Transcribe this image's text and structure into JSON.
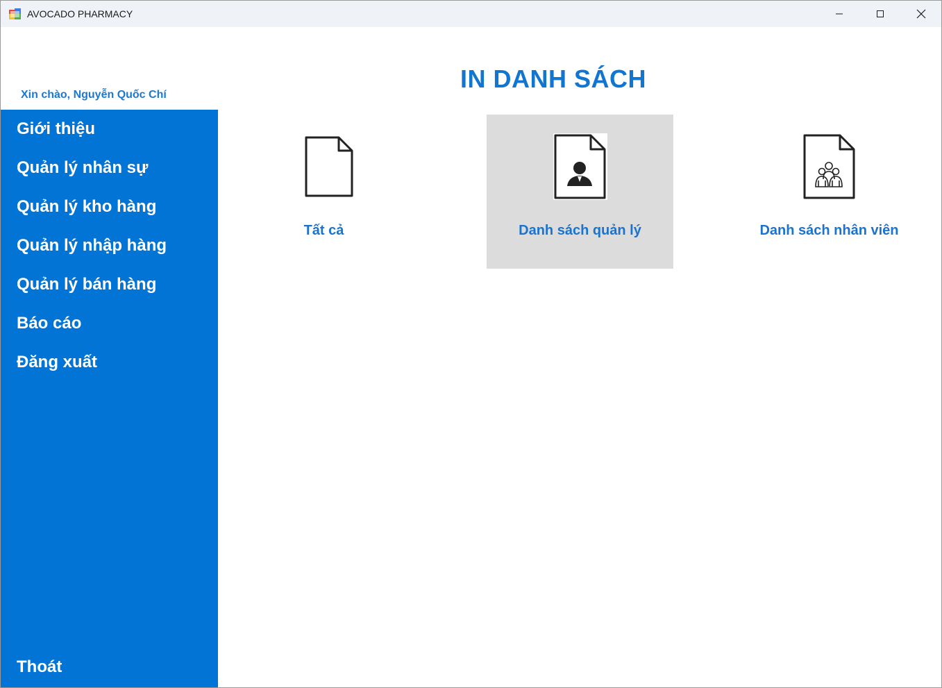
{
  "window": {
    "title": "AVOCADO PHARMACY",
    "controls": [
      "minimize-icon",
      "maximize-icon",
      "close-icon"
    ]
  },
  "user": {
    "greeting": "Xin chào, Nguyễn Quốc Chí"
  },
  "sidebar": {
    "items": [
      {
        "label": "Giới thiệu"
      },
      {
        "label": "Quản lý nhân sự"
      },
      {
        "label": "Quản lý kho hàng"
      },
      {
        "label": "Quản lý nhập hàng"
      },
      {
        "label": "Quản lý bán hàng"
      },
      {
        "label": "Báo cáo"
      },
      {
        "label": "Đăng xuất"
      }
    ],
    "exit_label": "Thoát"
  },
  "main": {
    "title": "IN DANH SÁCH",
    "cards": [
      {
        "label": "Tất cả",
        "icon": "blank-document-icon",
        "selected": false
      },
      {
        "label": "Danh sách quản lý",
        "icon": "manager-document-icon",
        "selected": true
      },
      {
        "label": "Danh sách nhân viên",
        "icon": "staff-document-icon",
        "selected": false
      }
    ]
  },
  "colors": {
    "sidebar_bg": "#0174d6",
    "accent_text": "#1275cf",
    "selected_card_bg": "#dcdcdc",
    "titlebar_bg": "#eff3f7"
  }
}
